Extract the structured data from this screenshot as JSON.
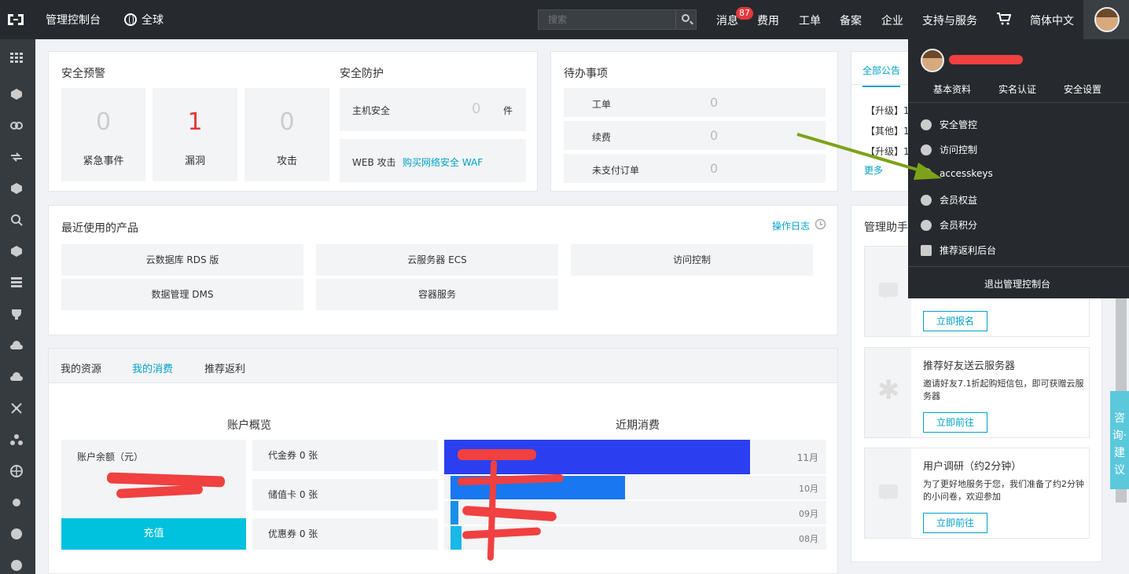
{
  "topbar": {
    "console_label": "管理控制台",
    "region_label": "全球",
    "search_placeholder": "搜索",
    "messages_label": "消息",
    "messages_badge": "87",
    "nav": [
      "费用",
      "工单",
      "备案",
      "企业",
      "支持与服务"
    ],
    "language_label": "简体中文"
  },
  "security_alert": {
    "title": "安全预警",
    "tiles": [
      {
        "value": "0",
        "label": "紧急事件",
        "color": "#cccccc"
      },
      {
        "value": "1",
        "label": "漏洞",
        "color": "#e4393c"
      },
      {
        "value": "0",
        "label": "攻击",
        "color": "#cccccc"
      }
    ]
  },
  "security_protect": {
    "title": "安全防护",
    "host_label": "主机安全",
    "host_value": "0",
    "host_unit": "件",
    "web_label": "WEB 攻击",
    "web_link": "购买网络安全 WAF"
  },
  "todo": {
    "title": "待办事项",
    "items": [
      {
        "label": "工单",
        "value": "0"
      },
      {
        "label": "续费",
        "value": "0"
      },
      {
        "label": "未支付订单",
        "value": "0"
      }
    ]
  },
  "announcements": {
    "tab": "全部公告",
    "items": [
      "【升级】1",
      "【其他】1",
      "【升级】1"
    ],
    "more": "更多"
  },
  "recent_products": {
    "title": "最近使用的产品",
    "log_link": "操作日志",
    "items": [
      "云数据库 RDS 版",
      "云服务器 ECS",
      "访问控制",
      "数据管理 DMS",
      "容器服务"
    ]
  },
  "bottom_tabs": [
    "我的资源",
    "我的消费",
    "推荐返利"
  ],
  "account": {
    "title": "账户概览",
    "balance_label": "账户余额（元）",
    "recharge": "充值",
    "coupons": [
      "代金券 0 张",
      "储值卡 0 张",
      "优惠券 0 张"
    ]
  },
  "recent_spend": {
    "title": "近期消费",
    "months": [
      "11月",
      "10月",
      "09月",
      "08月"
    ]
  },
  "assistant": {
    "title": "管理助手",
    "cards": [
      {
        "title": "",
        "desc": "",
        "button": "立即报名"
      },
      {
        "title": "推荐好友送云服务器",
        "desc": "邀请好友7.1折起购短信包，即可获赠云服务器",
        "button": "立即前往"
      },
      {
        "title": "用户调研（约2分钟）",
        "desc": "为了更好地服务于您，我们准备了约2分钟的小问卷，欢迎参加",
        "button": "立即前往"
      }
    ]
  },
  "user_menu": {
    "tabs": [
      "基本资料",
      "实名认证",
      "安全设置"
    ],
    "items": [
      {
        "label": "安全管控",
        "icon": "shield-icon"
      },
      {
        "label": "访问控制",
        "icon": "user-icon"
      },
      {
        "label": "accesskeys",
        "icon": "key-icon"
      },
      {
        "label": "会员权益",
        "icon": "diamond-icon"
      },
      {
        "label": "会员积分",
        "icon": "crown-icon"
      },
      {
        "label": "推荐返利后台",
        "icon": "document-icon"
      }
    ],
    "logout": "退出管理控制台"
  },
  "consult": "咨询·建议",
  "colors": {
    "accent": "#00a2ca",
    "topbar": "#262a2e",
    "sidebar": "#363b40",
    "alert": "#e4393c"
  }
}
